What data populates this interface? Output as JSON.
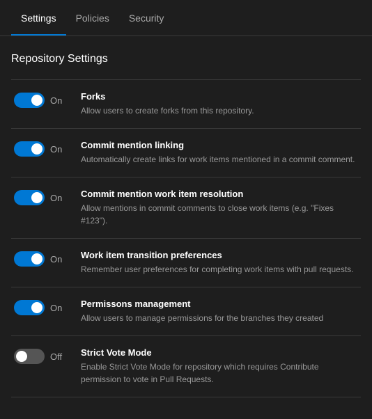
{
  "nav": {
    "tabs": [
      {
        "id": "settings",
        "label": "Settings",
        "active": true
      },
      {
        "id": "policies",
        "label": "Policies",
        "active": false
      },
      {
        "id": "security",
        "label": "Security",
        "active": false
      }
    ]
  },
  "section": {
    "title": "Repository Settings"
  },
  "settings": [
    {
      "id": "forks",
      "state": "on",
      "state_label": "On",
      "title": "Forks",
      "description": "Allow users to create forks from this repository."
    },
    {
      "id": "commit-mention-linking",
      "state": "on",
      "state_label": "On",
      "title": "Commit mention linking",
      "description": "Automatically create links for work items mentioned in a commit comment."
    },
    {
      "id": "commit-mention-work-item",
      "state": "on",
      "state_label": "On",
      "title": "Commit mention work item resolution",
      "description": "Allow mentions in commit comments to close work items (e.g. \"Fixes #123\")."
    },
    {
      "id": "work-item-transition",
      "state": "on",
      "state_label": "On",
      "title": "Work item transition preferences",
      "description": "Remember user preferences for completing work items with pull requests."
    },
    {
      "id": "permissions-management",
      "state": "on",
      "state_label": "On",
      "title": "Permissons management",
      "description": "Allow users to manage permissions for the branches they created"
    },
    {
      "id": "strict-vote-mode",
      "state": "off",
      "state_label": "Off",
      "title": "Strict Vote Mode",
      "description": "Enable Strict Vote Mode for repository which requires Contribute permission to vote in Pull Requests."
    }
  ]
}
